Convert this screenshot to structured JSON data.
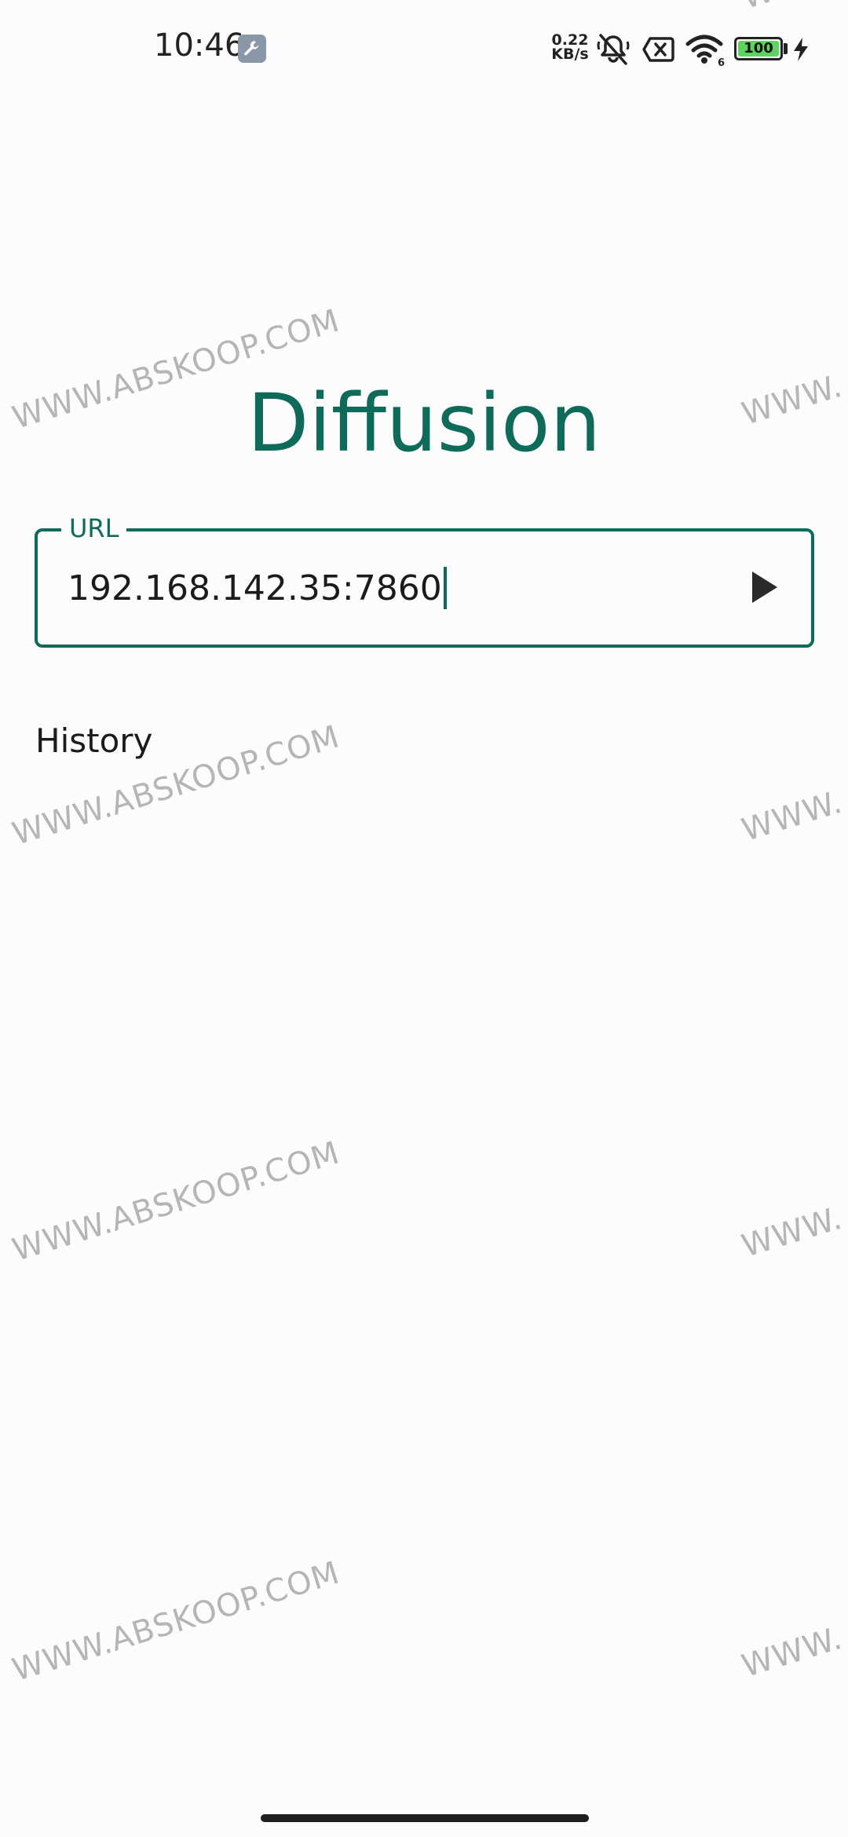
{
  "status_bar": {
    "time": "10:46",
    "net_speed_value": "0.22",
    "net_speed_unit": "KB/s",
    "battery_level": "100",
    "icons": [
      "wrench-icon",
      "bell-muted-icon",
      "sim-x-icon",
      "wifi-icon",
      "battery-icon",
      "charging-bolt-icon"
    ]
  },
  "app": {
    "title": "Diffusion"
  },
  "url_field": {
    "label": "URL",
    "value": "192.168.142.35:7860",
    "submit_icon": "play-arrow-icon"
  },
  "history": {
    "heading": "History"
  },
  "watermark": {
    "text": "WWW.ABSKOOP.COM",
    "partial_text": "WWW."
  },
  "colors": {
    "accent": "#0e6b5a",
    "background": "#fcfcfc",
    "text": "#1b1b1b",
    "watermark": "#9e9e9e",
    "battery_fill": "#5fd35f"
  }
}
